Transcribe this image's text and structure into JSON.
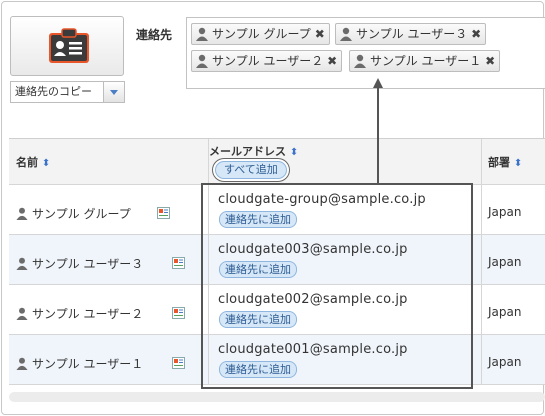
{
  "toolbar": {
    "copy_select_value": "連絡先のコピー",
    "icon": "contact-card-icon"
  },
  "recipients": {
    "label": "連絡先",
    "chips": [
      "サンプル グループ",
      "サンプル ユーザー３",
      "サンプル ユーザー２",
      "サンプル ユーザー１"
    ]
  },
  "table": {
    "headers": {
      "name": "名前",
      "email": "メールアドレス",
      "dept": "部署"
    },
    "add_all_label": "すべて追加",
    "add_label": "連絡先に追加",
    "rows": [
      {
        "name": "サンプル グループ",
        "email": "cloudgate-group@sample.co.jp",
        "dept": "Japan"
      },
      {
        "name": "サンプル ユーザー３",
        "email": "cloudgate003@sample.co.jp",
        "dept": "Japan"
      },
      {
        "name": "サンプル ユーザー２",
        "email": "cloudgate002@sample.co.jp",
        "dept": "Japan"
      },
      {
        "name": "サンプル ユーザー１",
        "email": "cloudgate001@sample.co.jp",
        "dept": "Japan"
      }
    ]
  },
  "colors": {
    "accent": "#3a73c9",
    "icon_orange": "#e8562a",
    "button_blue": "#d6e8f8"
  }
}
